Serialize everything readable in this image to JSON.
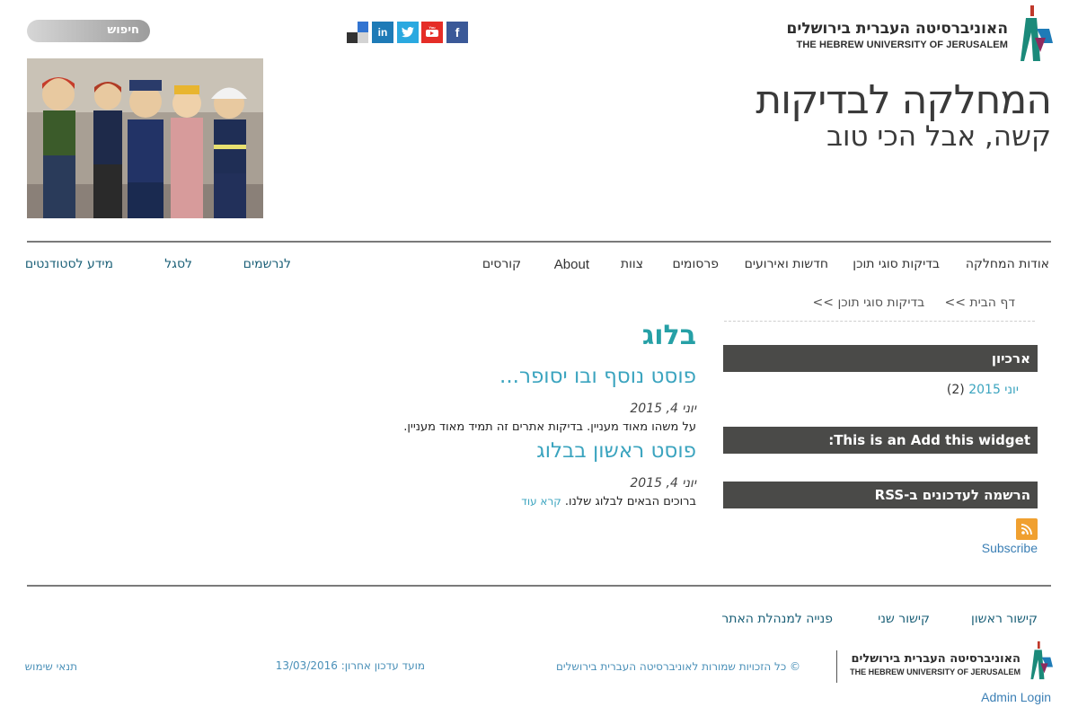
{
  "header": {
    "search_label": "חיפוש",
    "logo_hebrew": "האוניברסיטה העברית בירושלים",
    "logo_english": "THE HEBREW UNIVERSITY OF JERUSALEM",
    "site_title": "המחלקה לבדיקות",
    "site_subtitle": "קשה, אבל הכי טוב",
    "social": [
      {
        "icon": "facebook-icon",
        "glyph": "f",
        "color": "#3b5998"
      },
      {
        "icon": "youtube-icon",
        "glyph": "▶",
        "color": "#e52d27"
      },
      {
        "icon": "twitter-icon",
        "glyph": "t",
        "color": "#2aa9e0"
      },
      {
        "icon": "linkedin-icon",
        "glyph": "in",
        "color": "#1e7bb7"
      }
    ]
  },
  "nav": {
    "main_items": [
      "אודות המחלקה",
      "בדיקות סוגי תוכן",
      "חדשות ואירועים",
      "פרסומים",
      "צוות",
      "About",
      "קורסים"
    ],
    "secondary_items": [
      "לנרשמים",
      "לסגל",
      "מידע לסטודנטים"
    ]
  },
  "breadcrumb": {
    "home": "דף הבית >>",
    "current": "בדיקות סוגי תוכן >>"
  },
  "blog": {
    "title": "בלוג",
    "posts": [
      {
        "title": "פוסט נוסף ובו יסופר...",
        "date": "יוני 4, 2015",
        "body": "על משהו מאוד מעניין. בדיקות אתרים זה תמיד מאוד מעניין.",
        "read_more": ""
      },
      {
        "title": "פוסט ראשון בבלוג",
        "date": "יוני 4, 2015",
        "body": "ברוכים הבאים לבלוג שלנו.",
        "read_more": "קרא עוד"
      }
    ]
  },
  "sidebar": {
    "archive_title": "ארכיון",
    "archive_link": "יוני 2015",
    "archive_count": "(2)",
    "addthis_title": "This is an Add this widget:",
    "rss_title": "הרשמה לעדכונים ב-RSS",
    "subscribe": "Subscribe"
  },
  "footer": {
    "links": [
      "קישור ראשון",
      "קישור שני",
      "פנייה למנהלת האתר"
    ],
    "copyright": "© כל הזכויות שמורות לאוניברסיטה העברית בירושלים",
    "last_update": "מועד עדכון אחרון: 13/03/2016",
    "terms": "תנאי שימוש",
    "admin_login": "Admin Login",
    "logo_hebrew": "האוניברסיטה העברית בירושלים",
    "logo_english": "THE HEBREW UNIVERSITY OF JERUSALEM"
  },
  "colors": {
    "accent_teal": "#26a0a6",
    "link_blue": "#3ba4bf",
    "nav_dark": "#1a5f77",
    "widget_bar": "#4a4a48",
    "rss_orange": "#f0a030"
  }
}
